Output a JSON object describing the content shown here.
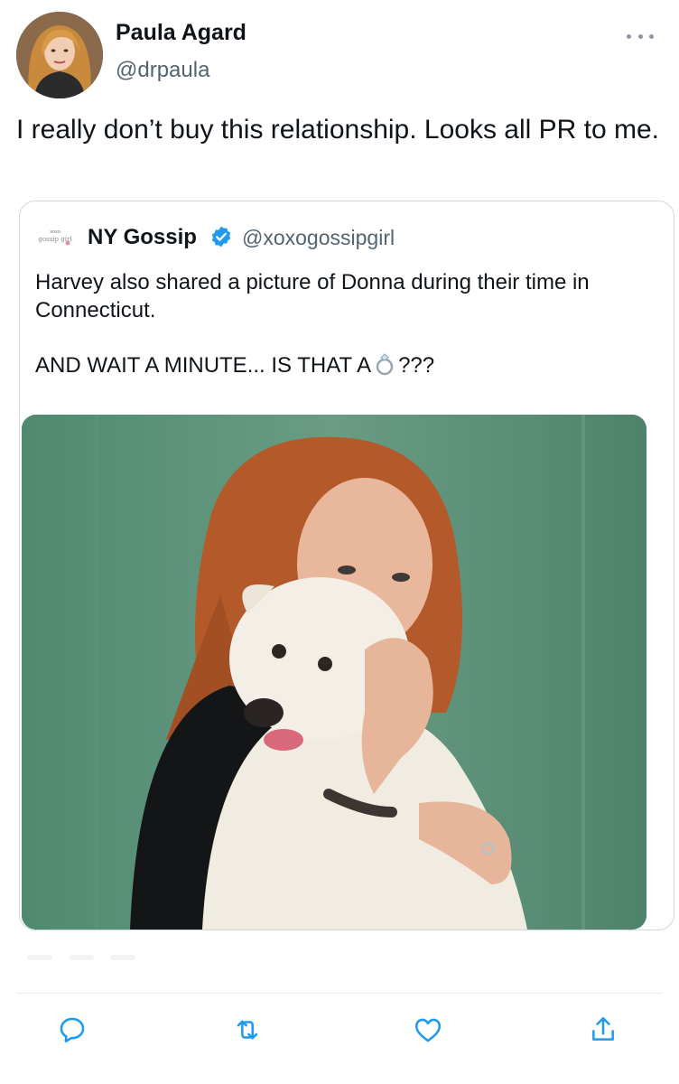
{
  "author": {
    "display_name": "Paula Agard",
    "handle": "@drpaula",
    "avatar_icon": "profile-photo"
  },
  "tweet": {
    "text": "I really don’t buy this relationship. Looks all PR to me."
  },
  "quoted_tweet": {
    "display_name": "NY Gossip",
    "handle": "@xoxogossipgirl",
    "verified": true,
    "avatar_text": "gossip girl",
    "paragraph_1": "Harvey also shared a picture of Donna during their time in Connecticut.",
    "paragraph_2_prefix": "AND WAIT A MINUTE... IS THAT A",
    "paragraph_2_emoji": "ring-emoji",
    "paragraph_2_suffix": "???",
    "image_icon": "photo-woman-holding-white-dog"
  },
  "actions": [
    {
      "name": "reply",
      "icon": "reply-icon"
    },
    {
      "name": "retweet",
      "icon": "retweet-icon"
    },
    {
      "name": "like",
      "icon": "heart-icon"
    },
    {
      "name": "share",
      "icon": "share-icon"
    }
  ],
  "colors": {
    "text": "#0f1419",
    "secondary": "#536471",
    "verified": "#1d9bf0",
    "border": "#cfd9de",
    "action_icon": "#1d9bf0"
  }
}
